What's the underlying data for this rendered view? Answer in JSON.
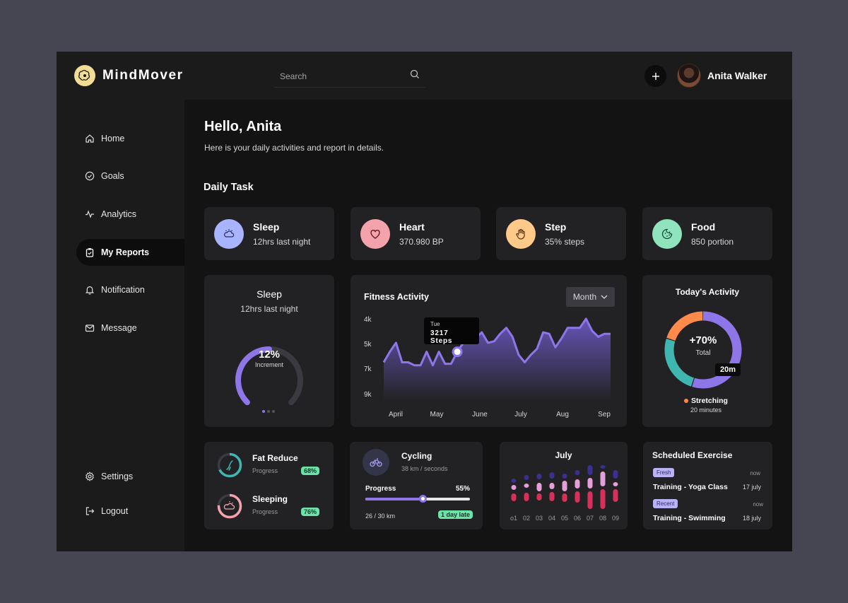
{
  "brand": {
    "name": "MindMover"
  },
  "search": {
    "placeholder": "Search"
  },
  "user": {
    "name": "Anita Walker"
  },
  "sidebar": {
    "items": [
      {
        "label": "Home",
        "icon": "home-icon"
      },
      {
        "label": "Goals",
        "icon": "check-circle-icon"
      },
      {
        "label": "Analytics",
        "icon": "pulse-icon"
      },
      {
        "label": "My Reports",
        "icon": "clipboard-icon",
        "active": true
      },
      {
        "label": "Notification",
        "icon": "bell-icon"
      },
      {
        "label": "Message",
        "icon": "mail-icon"
      }
    ],
    "bottom": [
      {
        "label": "Settings",
        "icon": "gear-icon"
      },
      {
        "label": "Logout",
        "icon": "logout-icon"
      }
    ]
  },
  "greeting": {
    "title": "Hello, Anita",
    "subtitle": "Here is your daily activities and report in details."
  },
  "daily_task": {
    "title": "Daily Task",
    "cards": [
      {
        "title": "Sleep",
        "value": "12hrs last night",
        "icon": "cloud-moon-icon",
        "color": "#a8b4ff"
      },
      {
        "title": "Heart",
        "value": "370.980 BP",
        "icon": "heart-icon",
        "color": "#f4a3ad"
      },
      {
        "title": "Step",
        "value": "35% steps",
        "icon": "hand-icon",
        "color": "#ffc98a"
      },
      {
        "title": "Food",
        "value": "850 portion",
        "icon": "cookie-icon",
        "color": "#8fe4be"
      }
    ]
  },
  "sleep_card": {
    "title": "Sleep",
    "subtitle": "12hrs last night",
    "percent": "12%",
    "caption": "Increment",
    "progress": 0.5
  },
  "fitness": {
    "title": "Fitness Activity",
    "period": "Month",
    "tooltip": {
      "day": "Tue",
      "value": "3217 Steps"
    },
    "y_ticks": [
      "4k",
      "5k",
      "7k",
      "9k"
    ],
    "x_ticks": [
      "April",
      "May",
      "June",
      "July",
      "Aug",
      "Sep"
    ]
  },
  "chart_data": {
    "type": "area",
    "x": [
      "April",
      "May",
      "June",
      "July",
      "Aug",
      "Sep"
    ],
    "y_ticks": [
      "4k",
      "5k",
      "7k",
      "9k"
    ],
    "series": [
      {
        "values": [
          6.9,
          6.2,
          5.6,
          6.9,
          6.9,
          7.1,
          7.1,
          6.2,
          7.1,
          6.2,
          7.0,
          7.0,
          6.2,
          5.6,
          5.2,
          5.3,
          4.9,
          5.6,
          5.5,
          5.0,
          4.6,
          5.2,
          6.4,
          6.9,
          6.4,
          6.0,
          4.9,
          5.0,
          5.9,
          5.3,
          4.6,
          4.6,
          4.6,
          4.0,
          4.8,
          5.2,
          5.0,
          5.0
        ],
        "color": "#8e76e8"
      }
    ],
    "highlight": {
      "label": "Tue",
      "value": "3217 Steps",
      "index": 12
    },
    "grid": false
  },
  "today_activity": {
    "title": "Today's Activity",
    "percent": "+70%",
    "total_label": "Total",
    "time_badge": "20m",
    "legend": {
      "label": "Stretching",
      "sub": "20 minutes",
      "color": "#ff8a4c"
    },
    "segments": [
      {
        "value": 0.55,
        "color": "#8e76e8"
      },
      {
        "value": 0.25,
        "color": "#3fb7b0"
      },
      {
        "value": 0.2,
        "color": "#ff8a4c"
      }
    ]
  },
  "progress_card": {
    "items": [
      {
        "title": "Fat Reduce",
        "sub": "Progress",
        "pill": "68%",
        "progress": 0.68,
        "color": "#3fb7b0",
        "icon": "leg-icon"
      },
      {
        "title": "Sleeping",
        "sub": "Progress",
        "pill": "76%",
        "progress": 0.76,
        "color": "#f4a3ad",
        "icon": "cloud-moon-icon"
      }
    ]
  },
  "cycling": {
    "title": "Cycling",
    "sub": "38 km / seconds",
    "progress_label": "Progress",
    "progress_value": "55%",
    "progress": 0.55,
    "distance": "26 / 30 km",
    "badge": "1 day late"
  },
  "july": {
    "title": "July",
    "days": [
      "o1",
      "02",
      "03",
      "04",
      "05",
      "06",
      "07",
      "08",
      "09"
    ]
  },
  "scheduled": {
    "title": "Scheduled Exercise",
    "items": [
      {
        "tag": "Fresh",
        "time": "now",
        "title": "Training - Yoga Class",
        "date": "17 july"
      },
      {
        "tag": "Recent",
        "time": "now",
        "title": "Training - Swimming",
        "date": "18 july"
      }
    ]
  },
  "colors": {
    "accent": "#8e76e8",
    "teal": "#3fb7b0",
    "orange": "#ff8a4c",
    "pink": "#f4a3ad",
    "green": "#6ee3a8"
  }
}
